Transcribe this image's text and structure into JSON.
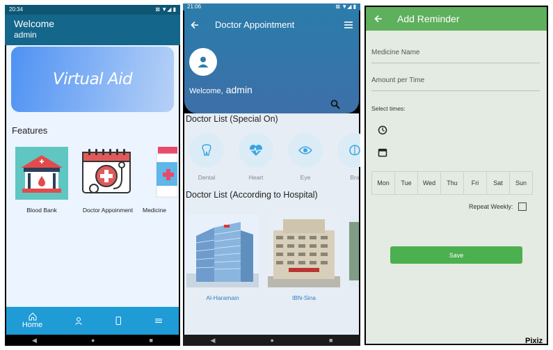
{
  "screen1": {
    "status_time": "20:34",
    "status_icons": "⊠ ▼◢ ▮",
    "welcome_title": "Welcome",
    "username": "admin",
    "banner_text": "Virtual Aid",
    "features_title": "Features",
    "features": [
      {
        "label": "Blood Bank",
        "icon": "blood-bank-icon"
      },
      {
        "label": "Doctor Appoinment",
        "icon": "doctor-appointment-icon"
      },
      {
        "label": "Medicine",
        "icon": "medicine-icon"
      }
    ],
    "bottom_nav": [
      {
        "label": "Home",
        "icon": "home-icon"
      },
      {
        "label": "",
        "icon": "person-icon"
      },
      {
        "label": "",
        "icon": "phone-icon"
      },
      {
        "label": "",
        "icon": "menu-icon"
      }
    ],
    "colors": {
      "appbar": "#14668a",
      "bottom_nav": "#1f9bd6",
      "banner_start": "#4f92f3"
    }
  },
  "screen2": {
    "status_time": "21:06",
    "status_icons": "⊠ ▼◢ ▮",
    "title": "Doctor Appointment",
    "welcome_text": "Welcome,",
    "username": "admin",
    "section_special": "Doctor List (Special On)",
    "categories": [
      {
        "label": "Dental",
        "icon": "tooth-icon"
      },
      {
        "label": "Heart",
        "icon": "heart-pulse-icon"
      },
      {
        "label": "Eye",
        "icon": "eye-icon"
      },
      {
        "label": "Bra",
        "icon": "brain-icon"
      }
    ],
    "section_hospital": "Doctor List (According to Hospital)",
    "hospitals": [
      {
        "label": "Al-Haramain"
      },
      {
        "label": "IBN-Sina"
      }
    ],
    "colors": {
      "header": "#2b7cab",
      "accent": "#2f7cc4"
    }
  },
  "screen3": {
    "title": "Add Reminder",
    "medicine_name_placeholder": "Medicine Name",
    "amount_placeholder": "Amount per Time",
    "select_times_label": "Select times:",
    "days": [
      "Mon",
      "Tue",
      "Wed",
      "Thu",
      "Fri",
      "Sat",
      "Sun"
    ],
    "repeat_label": "Repeat Weekly:",
    "repeat_checked": false,
    "save_label": "Save",
    "colors": {
      "appbar": "#5eb05c",
      "save": "#4caf50"
    }
  },
  "watermark": "Pixiz"
}
